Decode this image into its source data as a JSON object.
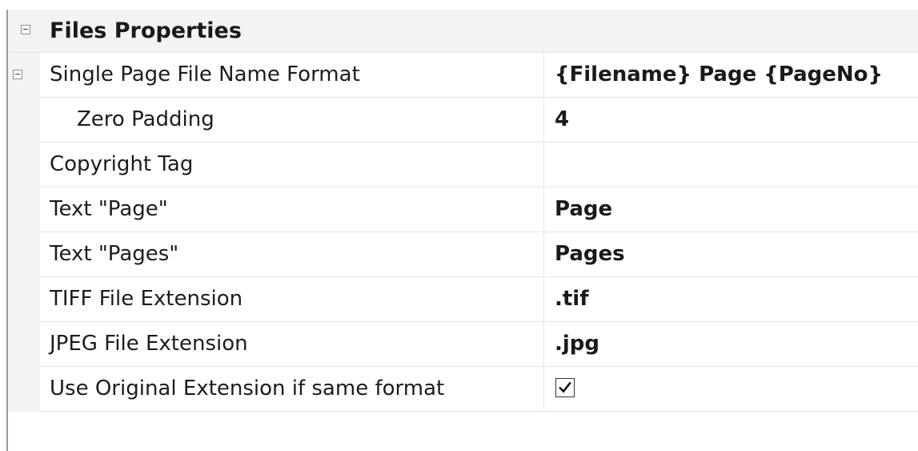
{
  "category": {
    "title": "Files Properties",
    "expanded": true,
    "toggle_icon": "collapse-minus-icon"
  },
  "properties": [
    {
      "key": "single_page_format",
      "name": "Single Page File Name Format",
      "value": "{Filename} Page {PageNo}",
      "expandable": true
    },
    {
      "key": "zero_padding",
      "name": "Zero Padding",
      "value": "4",
      "indent": true
    },
    {
      "key": "copyright_tag",
      "name": "Copyright Tag",
      "value": ""
    },
    {
      "key": "text_page",
      "name": "Text \"Page\"",
      "value": "Page"
    },
    {
      "key": "text_pages",
      "name": "Text \"Pages\"",
      "value": "Pages"
    },
    {
      "key": "tiff_ext",
      "name": "TIFF File Extension",
      "value": ".tif"
    },
    {
      "key": "jpeg_ext",
      "name": "JPEG File Extension",
      "value": ".jpg"
    },
    {
      "key": "use_original_ext",
      "name": "Use Original Extension if same format",
      "checked": true,
      "checkbox_icon": "checkmark-icon"
    }
  ],
  "colors": {
    "category_background": "#f3f3f3",
    "grid_line": "#e6e6e6",
    "left_rule": "#9a9a9a"
  }
}
